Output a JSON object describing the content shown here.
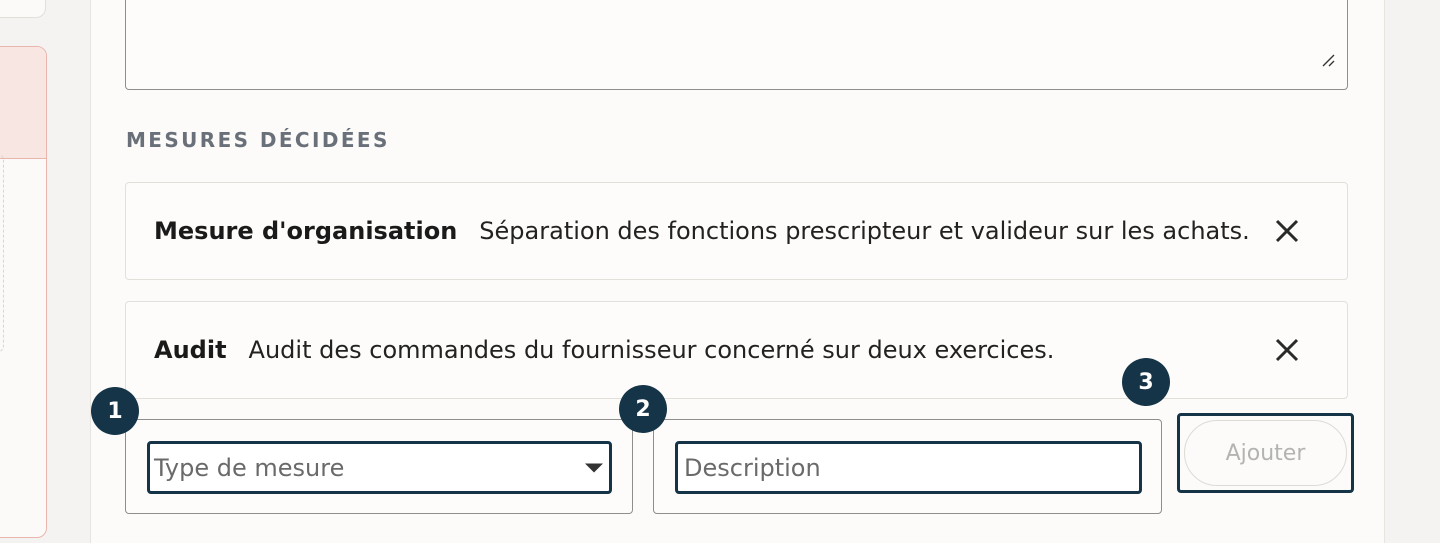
{
  "section": {
    "title": "MESURES DÉCIDÉES"
  },
  "measures": [
    {
      "type": "Mesure d'organisation",
      "description": "Séparation des fonctions prescripteur et valideur sur les achats."
    },
    {
      "type": "Audit",
      "description": "Audit des commandes du fournisseur concerné sur deux exercices."
    }
  ],
  "form": {
    "type_placeholder": "Type de mesure",
    "description_placeholder": "Description",
    "add_label": "Ajouter"
  },
  "badges": [
    "1",
    "2",
    "3"
  ],
  "colors": {
    "accent": "#153447",
    "alert_border": "#eab5ad",
    "alert_bg": "#f8e6e3"
  },
  "icons": {
    "remove": "close-icon",
    "select": "caret-down-icon",
    "resize": "resize-handle-icon"
  }
}
